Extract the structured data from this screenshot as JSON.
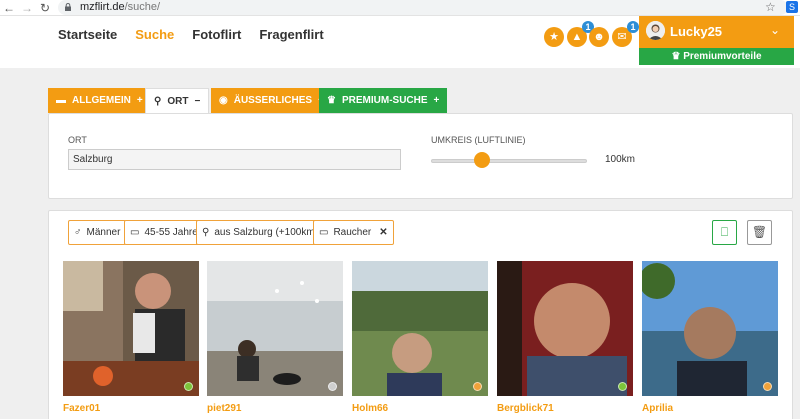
{
  "browser": {
    "url_domain": "mzflirt.de",
    "url_path": "/suche/"
  },
  "nav": {
    "items": [
      {
        "label": "Startseite",
        "active": false
      },
      {
        "label": "Suche",
        "active": true
      },
      {
        "label": "Fotoflirt",
        "active": false
      },
      {
        "label": "Fragenflirt",
        "active": false
      }
    ]
  },
  "header_icons": [
    {
      "icon": "star-icon",
      "badge": ""
    },
    {
      "icon": "bell-icon",
      "badge": "1"
    },
    {
      "icon": "smiley-icon",
      "badge": ""
    },
    {
      "icon": "chat-icon",
      "badge": "1"
    }
  ],
  "user": {
    "name": "Lucky25",
    "premium_label": "Premiumvorteile"
  },
  "tabs": {
    "allgemein": "ALLGEMEIN",
    "ort": "ORT",
    "ausserliches": "ÄUSSERLICHES",
    "premium": "PREMIUM-SUCHE"
  },
  "search": {
    "ort_label": "ORT",
    "ort_value": "Salzburg",
    "umkreis_label": "UMKREIS (LUFTLINIE)",
    "umkreis_value": "100km",
    "umkreis_fraction": 0.33
  },
  "filters": {
    "gender": "Männer",
    "age": "45-55 Jahre",
    "location": "aus Salzburg (+100km)",
    "smoker": "Raucher"
  },
  "profiles": [
    {
      "name": "Fazer01",
      "status_color": "#7cc43a"
    },
    {
      "name": "piet291",
      "status_color": "#cfcfcf"
    },
    {
      "name": "Holm66",
      "status_color": "#f0a23a"
    },
    {
      "name": "Bergblick71",
      "status_color": "#7cc43a"
    },
    {
      "name": "Aprilia",
      "status_color": "#f0a23a"
    }
  ],
  "colors": {
    "accent": "#f39c12",
    "premium_green": "#28a745",
    "badge_blue": "#2d8ed6"
  }
}
